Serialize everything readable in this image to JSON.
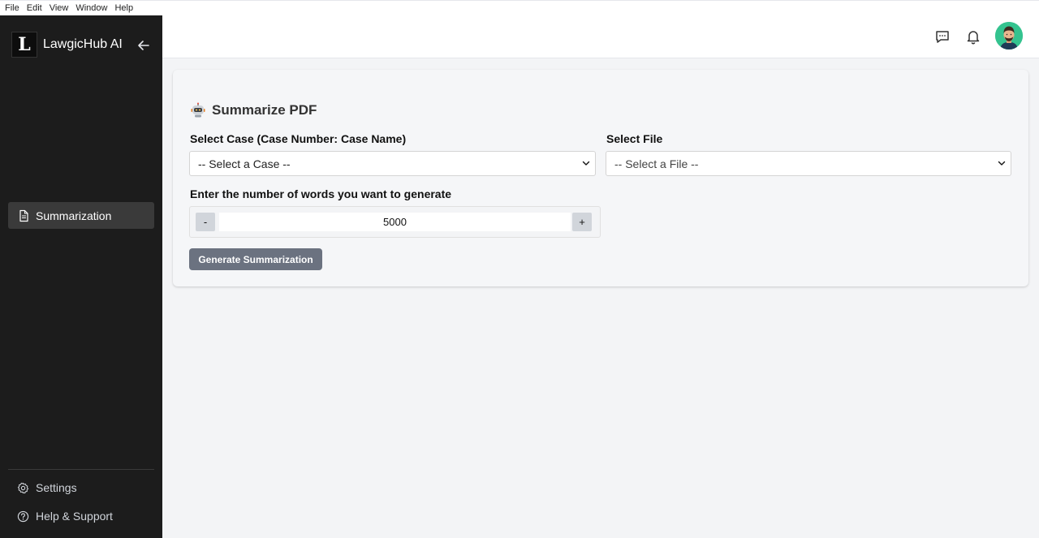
{
  "menubar": {
    "items": [
      "File",
      "Edit",
      "View",
      "Window",
      "Help"
    ]
  },
  "sidebar": {
    "brand": "LawgicHub AI",
    "logo_letter": "L",
    "nav": [
      {
        "label": "Summarization",
        "icon": "document-icon",
        "active": true
      }
    ],
    "footer": [
      {
        "label": "Settings",
        "icon": "gear-icon"
      },
      {
        "label": "Help & Support",
        "icon": "help-circle-icon"
      }
    ]
  },
  "topbar": {
    "icons": [
      "chat-icon",
      "bell-icon",
      "avatar"
    ]
  },
  "main": {
    "title": "Summarize PDF",
    "title_icon": "robot-icon",
    "case": {
      "label": "Select Case (Case Number: Case Name)",
      "value": "-- Select a Case --"
    },
    "file": {
      "label": "Select File",
      "value": "-- Select a File --"
    },
    "words": {
      "label": "Enter the number of words you want to generate",
      "value": "5000",
      "minus": "-",
      "plus": "+"
    },
    "generate_label": "Generate Summarization"
  },
  "colors": {
    "sidebar_bg": "#1c1c1c",
    "active_item": "#3a3a3a",
    "button": "#6b7280",
    "avatar_bg": "#34c38f"
  }
}
